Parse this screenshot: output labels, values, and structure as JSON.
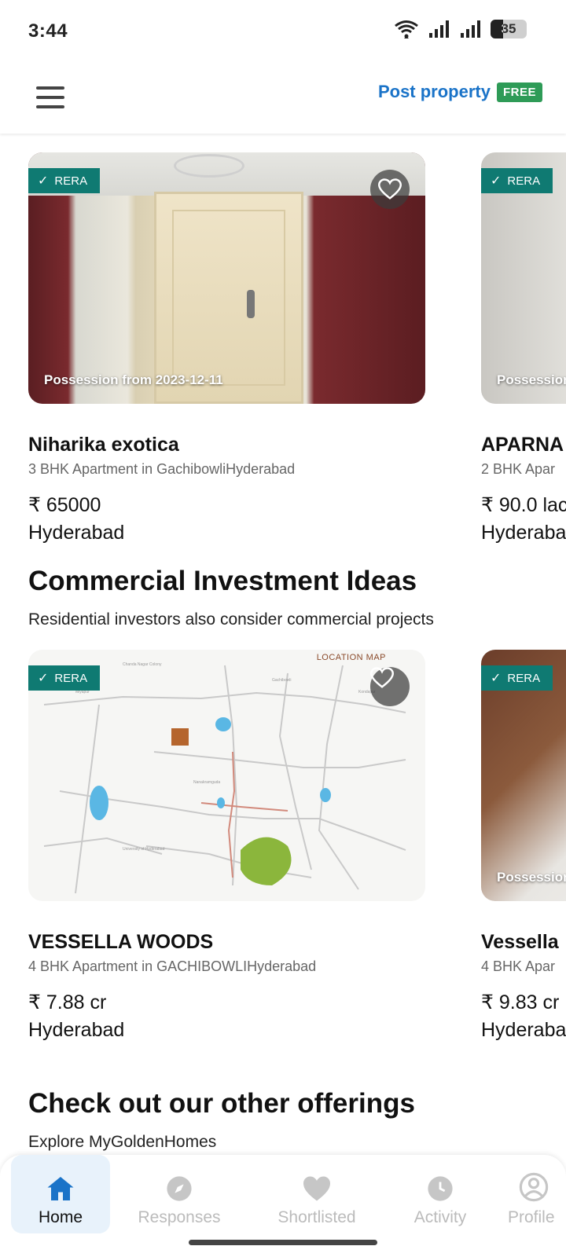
{
  "status_bar": {
    "time": "3:44",
    "battery": "35"
  },
  "top_bar": {
    "post_label": "Post property",
    "free_badge": "FREE"
  },
  "carousel_1": [
    {
      "rera": "RERA",
      "possession": "Possession from 2023-12-11",
      "title": "Niharika exotica",
      "subtitle": "3 BHK Apartment in GachibowliHyderabad",
      "price": "₹ 65000",
      "city": "Hyderabad"
    },
    {
      "rera": "RERA",
      "possession": "Possession",
      "title": "APARNA",
      "subtitle": "2 BHK Apar",
      "price": "₹ 90.0 lac",
      "city": "Hyderaba"
    }
  ],
  "section_commercial": {
    "title": "Commercial Investment Ideas",
    "subtitle": "Residential investors also consider commercial projects"
  },
  "carousel_2": [
    {
      "rera": "RERA",
      "map_title": "LOCATION MAP",
      "title": "VESSELLA WOODS",
      "subtitle": "4 BHK Apartment in GACHIBOWLIHyderabad",
      "price": "₹ 7.88 cr",
      "city": "Hyderabad"
    },
    {
      "rera": "RERA",
      "possession": "Possession",
      "title": "Vessella",
      "subtitle": "4 BHK Apar",
      "price": "₹ 9.83 cr",
      "city": "Hyderaba"
    }
  ],
  "section_offerings": {
    "title": "Check out our other offerings",
    "subtitle": "Explore MyGoldenHomes"
  },
  "bottom_nav": {
    "home": "Home",
    "responses": "Responses",
    "shortlisted": "Shortlisted",
    "activity": "Activity",
    "profile": "Profile"
  },
  "colors": {
    "accent": "#1a73c8",
    "rera": "#0f7a72",
    "free": "#2e9b57",
    "active_nav_bg": "#e8f2fb"
  }
}
